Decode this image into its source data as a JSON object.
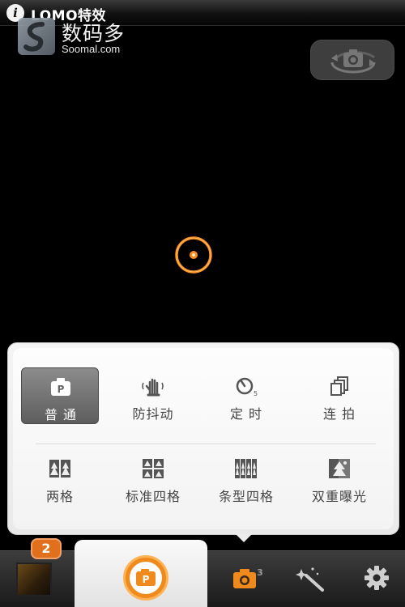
{
  "header": {
    "title": "LOMO特效",
    "info_icon": "info-icon"
  },
  "watermark": {
    "brand": "数码多",
    "site": "Soomal.com"
  },
  "controls": {
    "switch_camera_icon": "camera-switch-icon",
    "focus_icon": "focus-ring-icon"
  },
  "modes_panel": {
    "row1": [
      {
        "label": "普 通",
        "icon": "camera-p-icon",
        "selected": true
      },
      {
        "label": "防抖动",
        "icon": "hand-stabilize-icon",
        "selected": false
      },
      {
        "label": "定 时",
        "icon": "timer-5-icon",
        "selected": false
      },
      {
        "label": "连 拍",
        "icon": "burst-icon",
        "selected": false
      }
    ],
    "row2": [
      {
        "label": "两格",
        "icon": "two-grid-icon"
      },
      {
        "label": "标准四格",
        "icon": "four-grid-icon"
      },
      {
        "label": "条型四格",
        "icon": "strip-four-icon"
      },
      {
        "label": "双重曝光",
        "icon": "double-exposure-icon"
      }
    ]
  },
  "bottom_bar": {
    "gallery_badge": "2",
    "gallery_icon": "gallery-thumbnail",
    "shutter_icon": "shutter-p-icon",
    "camera_mode_icon": "camera-mode-icon",
    "effects_icon": "magic-wand-icon",
    "settings_icon": "gear-icon"
  },
  "colors": {
    "accent": "#f08a1c",
    "panel_bg": "#f4f4f4",
    "background": "#000000"
  }
}
